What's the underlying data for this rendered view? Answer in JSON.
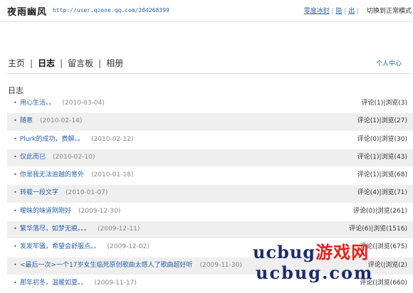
{
  "header": {
    "site_title": "夜雨幽风",
    "url": "http://user.qzone.qq.com/284268399",
    "links": {
      "zero_ice": "零度冰封",
      "hide": "隐",
      "exit": "出",
      "switch_mode": "切换到正常模式"
    }
  },
  "nav": {
    "tabs": [
      "主页",
      "日志",
      "留言板",
      "相册"
    ],
    "active": "日志",
    "personal_center": "个人中心"
  },
  "section_title": "日志",
  "posts": [
    {
      "title": "用心生活。。",
      "date": "(2010-03-04)",
      "comments": "评论(1)",
      "views": "浏览(3)"
    },
    {
      "title": "随意",
      "date": "(2010-02-14)",
      "comments": "评论(1)",
      "views": "浏览(27)"
    },
    {
      "title": "Plurk的成功，费解。。",
      "date": "(2010-02-12)",
      "comments": "评论(0)",
      "views": "浏览(30)"
    },
    {
      "title": "仅此而已",
      "date": "(2010-02-10)",
      "comments": "评论(1)",
      "views": "浏览(43)"
    },
    {
      "title": "你是我无法逾越的意外",
      "date": "(2010-01-18)",
      "comments": "评论(1)",
      "views": "浏览(68)"
    },
    {
      "title": "转载一段文字",
      "date": "(2010-01-07)",
      "comments": "评论(4)",
      "views": "浏览(71)"
    },
    {
      "title": "暧昧的味道刚刚好",
      "date": "(2009-12-30)",
      "comments": "评论(0)",
      "views": "浏览(261)"
    },
    {
      "title": "繁华落尽，如梦无痕。。。",
      "date": "(2009-12-11)",
      "comments": "评论(6)",
      "views": "浏览(1516)"
    },
    {
      "title": "发发牢骚，希望会舒服点。。",
      "date": "(2009-12-02)",
      "comments": "评论(",
      "views": "浏览(675)"
    },
    {
      "title": "<最后一次>一个17岁女生临死原创歌曲太感人了歌曲超好听",
      "date": "(2009-11-30)",
      "comments": "评论(",
      "views": "浏览(2)"
    },
    {
      "title": "那年初冬，温暖如夏。。",
      "date": "(2009-11-17)",
      "comments": "评论(",
      "views": "浏览(660)"
    }
  ],
  "watermark": {
    "line1_a": "ucbug",
    "line1_b": "游戏网",
    "line2": "ucbug.com"
  }
}
